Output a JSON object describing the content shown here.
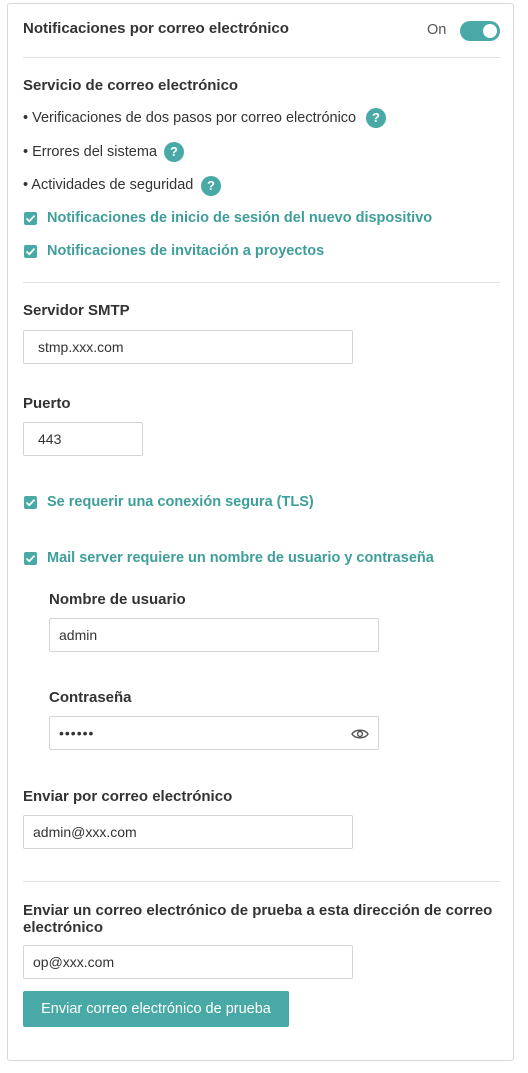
{
  "header": {
    "title": "Notificaciones por correo electrónico",
    "toggle_label": "On",
    "toggle_on": true
  },
  "email_service": {
    "title": "Servicio de correo electrónico",
    "bullets": [
      "• Verificaciones de dos pasos por correo electrónico",
      "• Errores del sistema",
      "• Actividades de seguridad"
    ],
    "help_glyph": "?",
    "checkboxes": [
      {
        "label": "Notificaciones de inicio de sesión del nuevo dispositivo",
        "checked": true
      },
      {
        "label": "Notificaciones de invitación a proyectos",
        "checked": true
      }
    ]
  },
  "smtp": {
    "label": "Servidor SMTP",
    "value": "stmp.xxx.com"
  },
  "port": {
    "label": "Puerto",
    "value": "443"
  },
  "tls": {
    "label": "Se requerir una conexión segura (TLS)",
    "checked": true
  },
  "auth": {
    "label": "Mail server requiere un nombre de usuario y contraseña",
    "checked": true,
    "username_label": "Nombre de usuario",
    "username_value": "admin",
    "password_label": "Contraseña",
    "password_value": "••••••"
  },
  "sender": {
    "label": "Enviar por correo electrónico",
    "value": "admin@xxx.com"
  },
  "test": {
    "label": "Enviar un correo electrónico de prueba a esta dirección de correo electrónico",
    "value": "op@xxx.com",
    "button_label": "Enviar correo electrónico de prueba"
  },
  "colors": {
    "accent": "#48a9a6",
    "accent_text": "#3d9e9a"
  },
  "icons": {
    "checkbox": "check-icon",
    "help": "help-icon",
    "password_visibility": "eye-icon"
  }
}
